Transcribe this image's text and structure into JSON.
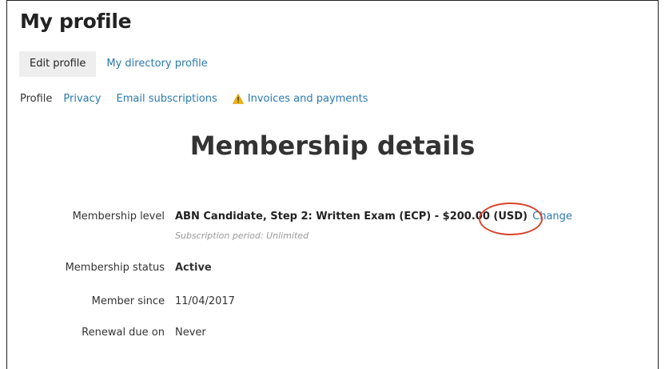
{
  "page": {
    "title": "My profile"
  },
  "tabs": [
    {
      "label": "Edit profile"
    },
    {
      "label": "My directory profile"
    }
  ],
  "subnav": {
    "profile": "Profile",
    "privacy": "Privacy",
    "email": "Email subscriptions",
    "invoices": "Invoices and payments",
    "warning_icon": "warning-triangle-icon"
  },
  "section": {
    "heading": "Membership details"
  },
  "details": {
    "level": {
      "label": "Membership level",
      "value": "ABN Candidate, Step 2: Written Exam (ECP) - $200.00 (USD)",
      "action": "Change",
      "subtitle": "Subscription period: Unlimited"
    },
    "status": {
      "label": "Membership status",
      "value": "Active"
    },
    "since": {
      "label": "Member since",
      "value": "11/04/2017"
    },
    "renewal": {
      "label": "Renewal due on",
      "value": "Never"
    }
  },
  "colors": {
    "link": "#2a7ab0",
    "annotation": "#d8432b",
    "warning": "#f0b400"
  }
}
